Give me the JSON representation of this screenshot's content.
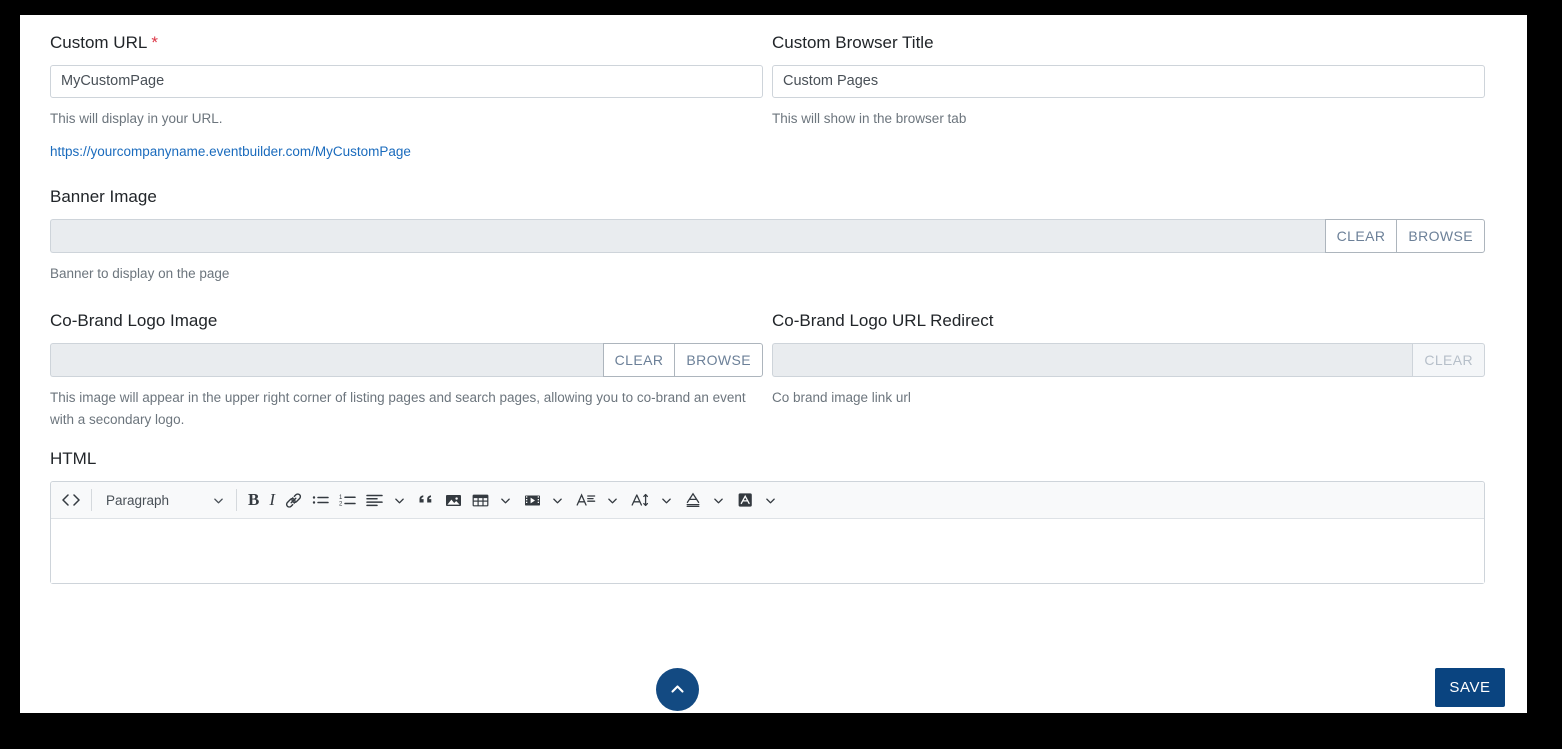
{
  "fields": {
    "custom_url": {
      "label": "Custom URL",
      "required_mark": "*",
      "value": "MyCustomPage",
      "help": "This will display in your URL.",
      "preview_url": "https://yourcompanyname.eventbuilder.com/MyCustomPage"
    },
    "custom_browser_title": {
      "label": "Custom Browser Title",
      "value": "Custom Pages",
      "help": "This will show in the browser tab"
    },
    "banner_image": {
      "label": "Banner Image",
      "value": "",
      "help": "Banner to display on the page",
      "clear_label": "CLEAR",
      "browse_label": "BROWSE"
    },
    "cobrand_logo_image": {
      "label": "Co-Brand Logo Image",
      "value": "",
      "help": "This image will appear in the upper right corner of listing pages and search pages, allowing you to co-brand an event with a secondary logo.",
      "clear_label": "CLEAR",
      "browse_label": "BROWSE"
    },
    "cobrand_logo_url_redirect": {
      "label": "Co-Brand Logo URL Redirect",
      "value": "",
      "help": "Co brand image link url",
      "clear_label": "CLEAR"
    },
    "html": {
      "label": "HTML",
      "content": ""
    }
  },
  "editor_toolbar": {
    "source_code": "<>",
    "block_format": "Paragraph",
    "bold": "B",
    "italic": "I",
    "font_family_glyph": "A",
    "font_size_glyph": "A",
    "text_color_glyph": "A",
    "highlight_glyph": "A"
  },
  "footer": {
    "save_label": "SAVE",
    "scroll_top_title": "Scroll to top"
  },
  "colors": {
    "accent": "#0a4480",
    "fab": "#134a82",
    "link": "#1a6bbd",
    "required": "#dc3545",
    "disabled_bg": "#e9ecef"
  }
}
